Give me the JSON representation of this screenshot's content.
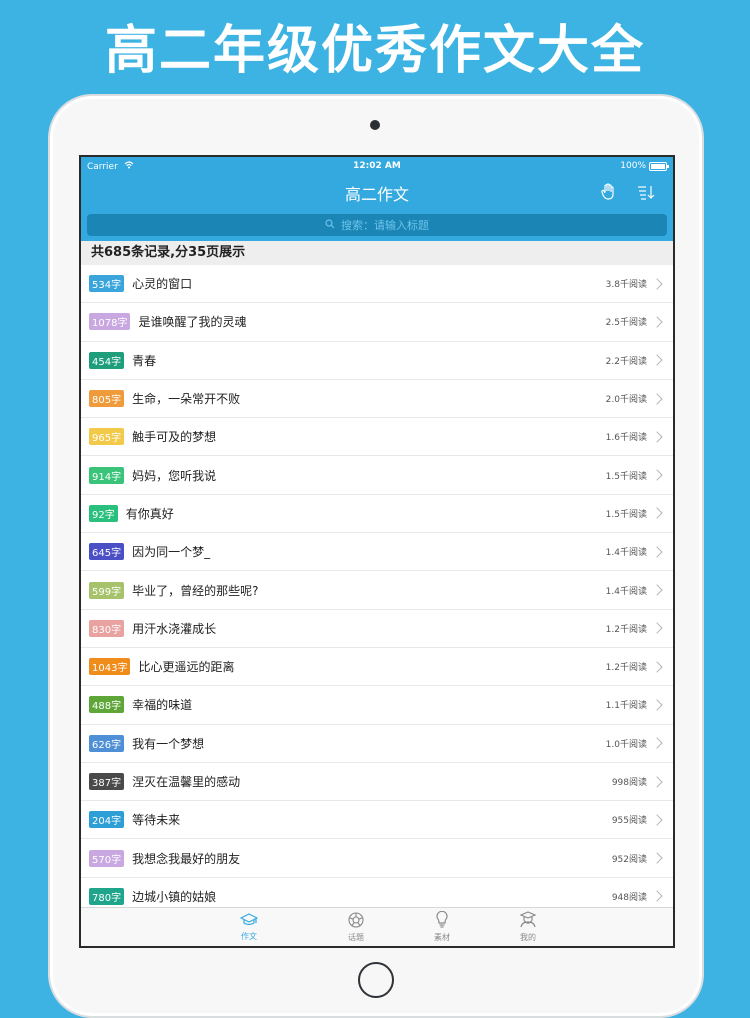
{
  "promo": {
    "title": "高二年级优秀作文大全"
  },
  "status_bar": {
    "carrier": "Carrier",
    "time": "12:02 AM",
    "battery": "100%"
  },
  "nav": {
    "title": "高二作文",
    "right_icons": [
      "hand-icon",
      "sort-icon"
    ]
  },
  "search": {
    "placeholder": "搜索：请输入标题"
  },
  "summary": "共685条记录,分35页展示",
  "items": [
    {
      "words": "534字",
      "title": "心灵的窗口",
      "reads": "3.8千阅读",
      "badge_color": "#3aa5dd"
    },
    {
      "words": "1078字",
      "title": "是谁唤醒了我的灵魂",
      "reads": "2.5千阅读",
      "badge_color": "#c9a8e2"
    },
    {
      "words": "454字",
      "title": "青春",
      "reads": "2.2千阅读",
      "badge_color": "#1f9e7c"
    },
    {
      "words": "805字",
      "title": "生命，一朵常开不败",
      "reads": "2.0千阅读",
      "badge_color": "#ef9b3b"
    },
    {
      "words": "965字",
      "title": "触手可及的梦想",
      "reads": "1.6千阅读",
      "badge_color": "#f3c94a"
    },
    {
      "words": "914字",
      "title": "妈妈，您听我说",
      "reads": "1.5千阅读",
      "badge_color": "#39c47a"
    },
    {
      "words": "92字",
      "title": "有你真好",
      "reads": "1.5千阅读",
      "badge_color": "#29c07e"
    },
    {
      "words": "645字",
      "title": "因为同一个梦_",
      "reads": "1.4千阅读",
      "badge_color": "#4b4fc6"
    },
    {
      "words": "599字",
      "title": "毕业了，曾经的那些呢?",
      "reads": "1.4千阅读",
      "badge_color": "#a6c26a"
    },
    {
      "words": "830字",
      "title": "用汗水浇灌成长",
      "reads": "1.2千阅读",
      "badge_color": "#e8a3a0"
    },
    {
      "words": "1043字",
      "title": "比心更遥远的距离",
      "reads": "1.2千阅读",
      "badge_color": "#f08c1a"
    },
    {
      "words": "488字",
      "title": "幸福的味道",
      "reads": "1.1千阅读",
      "badge_color": "#5ea638"
    },
    {
      "words": "626字",
      "title": "我有一个梦想",
      "reads": "1.0千阅读",
      "badge_color": "#4f8fd6"
    },
    {
      "words": "387字",
      "title": "涅灭在温馨里的感动",
      "reads": "998阅读",
      "badge_color": "#4a4a4a"
    },
    {
      "words": "204字",
      "title": "等待未来",
      "reads": "955阅读",
      "badge_color": "#2e9fd6"
    },
    {
      "words": "570字",
      "title": "我想念我最好的朋友",
      "reads": "952阅读",
      "badge_color": "#c9a8e2"
    },
    {
      "words": "780字",
      "title": "边城小镇的姑娘",
      "reads": "948阅读",
      "badge_color": "#1fa58c"
    }
  ],
  "tabs": [
    {
      "label": "作文",
      "icon": "graduation-cap-icon",
      "active": true
    },
    {
      "label": "话题",
      "icon": "aperture-icon",
      "active": false
    },
    {
      "label": "素材",
      "icon": "lightbulb-icon",
      "active": false
    },
    {
      "label": "我的",
      "icon": "user-icon",
      "active": false
    }
  ],
  "colors": {
    "background": "#3db3e3",
    "header": "#33a9e0",
    "search_field": "#1b86b5",
    "active_tab": "#33a9e0"
  }
}
